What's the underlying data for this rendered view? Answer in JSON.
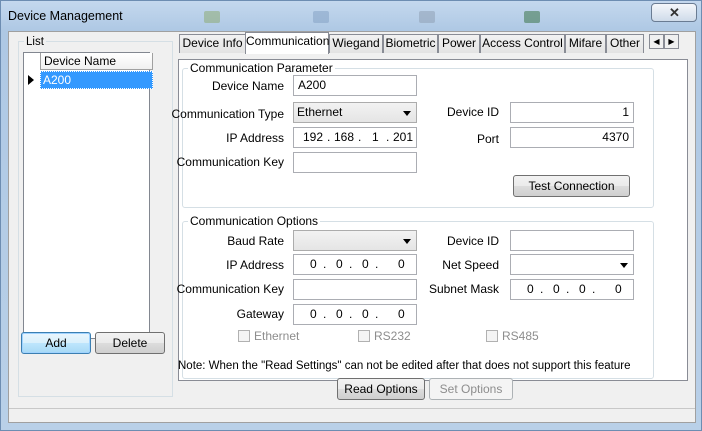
{
  "window": {
    "title": "Device Management",
    "close_glyph": "✕"
  },
  "list": {
    "legend": "List",
    "column_header": "Device Name",
    "rows": [
      {
        "name": "A200"
      }
    ]
  },
  "buttons": {
    "add": "Add",
    "delete": "Delete",
    "test_connection": "Test Connection",
    "read_options": "Read Options",
    "set_options": "Set Options"
  },
  "tabs": [
    {
      "label": "Device Info"
    },
    {
      "label": "Communication",
      "active": true
    },
    {
      "label": "Wiegand"
    },
    {
      "label": "Biometric"
    },
    {
      "label": "Power"
    },
    {
      "label": "Access Control"
    },
    {
      "label": "Mifare"
    },
    {
      "label": "Other"
    }
  ],
  "comm_param": {
    "legend": "Communication Parameter",
    "device_name_label": "Device Name",
    "device_name": "A200",
    "comm_type_label": "Communication Type",
    "comm_type": "Ethernet",
    "device_id_label": "Device ID",
    "device_id": "1",
    "ip_label": "IP Address",
    "ip": [
      "192",
      "168",
      "1",
      "201"
    ],
    "port_label": "Port",
    "port": "4370",
    "comm_key_label": "Communication Key",
    "comm_key": ""
  },
  "comm_options": {
    "legend": "Communication Options",
    "baud_label": "Baud Rate",
    "baud": "",
    "device_id_label": "Device ID",
    "device_id": "",
    "ip_label": "IP Address",
    "ip": [
      "0",
      "0",
      "0",
      "0"
    ],
    "net_speed_label": "Net Speed",
    "net_speed": "",
    "comm_key_label": "Communication Key",
    "comm_key": "",
    "subnet_label": "Subnet Mask",
    "subnet": [
      "0",
      "0",
      "0",
      "0"
    ],
    "gateway_label": "Gateway",
    "gateway": [
      "0",
      "0",
      "0",
      "0"
    ],
    "ethernet_label": "Ethernet",
    "rs232_label": "RS232",
    "rs485_label": "RS485"
  },
  "note": "Note: When the \"Read Settings\" can not be edited after that does not support this feature"
}
